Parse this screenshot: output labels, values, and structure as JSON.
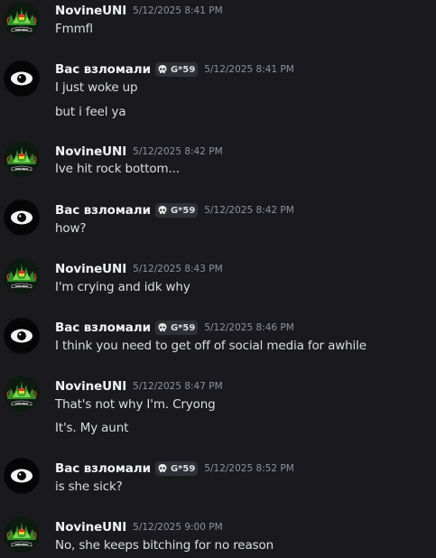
{
  "messages": [
    {
      "author": "NovineUNI",
      "tag": "",
      "time": "5/12/2025 8:41 PM",
      "avatar": "novine-avatar",
      "lines": [
        "Fmmfl"
      ]
    },
    {
      "author": "Вас взломали",
      "tag": "G*59",
      "time": "5/12/2025 8:41 PM",
      "avatar": "eye-avatar",
      "lines": [
        "I just woke up",
        "but i feel ya"
      ]
    },
    {
      "author": "NovineUNI",
      "tag": "",
      "time": "5/12/2025 8:42 PM",
      "avatar": "novine-avatar",
      "lines": [
        "Ive hit rock bottom..."
      ]
    },
    {
      "author": "Вас взломали",
      "tag": "G*59",
      "time": "5/12/2025 8:42 PM",
      "avatar": "eye-avatar",
      "lines": [
        "how?"
      ]
    },
    {
      "author": "NovineUNI",
      "tag": "",
      "time": "5/12/2025 8:43 PM",
      "avatar": "novine-avatar",
      "lines": [
        "I'm crying and idk why"
      ]
    },
    {
      "author": "Вас взломали",
      "tag": "G*59",
      "time": "5/12/2025 8:46 PM",
      "avatar": "eye-avatar",
      "lines": [
        "I think you need to get off of social media for awhile"
      ]
    },
    {
      "author": "NovineUNI",
      "tag": "",
      "time": "5/12/2025 8:47 PM",
      "avatar": "novine-avatar",
      "lines": [
        "That's not why I'm. Cryong",
        "It's. My aunt"
      ]
    },
    {
      "author": "Вас взломали",
      "tag": "G*59",
      "time": "5/12/2025 8:52 PM",
      "avatar": "eye-avatar",
      "lines": [
        "is she sick?"
      ]
    },
    {
      "author": "NovineUNI",
      "tag": "",
      "time": "5/12/2025 9:00 PM",
      "avatar": "novine-avatar",
      "lines": [
        "No, she keeps bitching for no reason"
      ]
    }
  ],
  "colors": {
    "background": "#1a1a1e",
    "username": "#f2f3f5",
    "text": "#dbdee1",
    "timestamp": "#8f929a",
    "tag_bg": "#2f3036"
  }
}
